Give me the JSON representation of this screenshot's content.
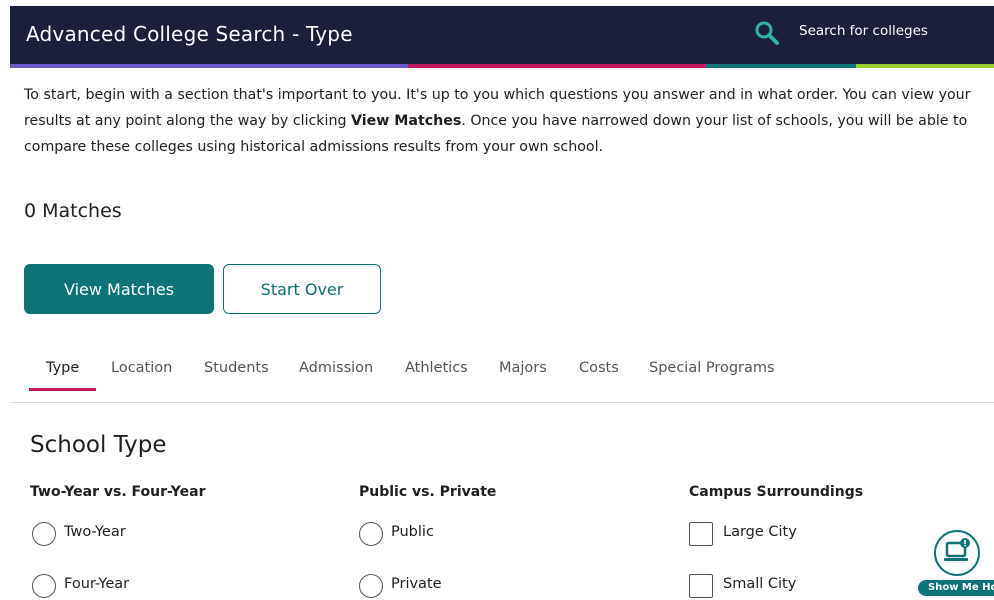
{
  "header": {
    "title": "Advanced College Search - Type",
    "search_label": "Search for colleges",
    "accent_colors": [
      "#6a5acd",
      "#c0175d",
      "#0d7377",
      "#9acd32"
    ]
  },
  "intro": {
    "part1": "To start, begin with a section that's important to you. It's up to you which questions you answer and in what order. You can view your results at any point along the way by clicking ",
    "bold": "View Matches",
    "part2": ". Once you have narrowed down your list of schools, you will be able to compare these colleges using historical admissions results from your own school."
  },
  "matches": {
    "count_text": "0 Matches"
  },
  "buttons": {
    "view_matches": "View Matches",
    "start_over": "Start Over"
  },
  "tabs": [
    {
      "label": "Type",
      "active": true
    },
    {
      "label": "Location"
    },
    {
      "label": "Students"
    },
    {
      "label": "Admission"
    },
    {
      "label": "Athletics"
    },
    {
      "label": "Majors"
    },
    {
      "label": "Costs"
    },
    {
      "label": "Special Programs"
    }
  ],
  "section": {
    "title": "School Type",
    "groups": [
      {
        "heading": "Two-Year vs. Four-Year",
        "type": "radio",
        "options": [
          "Two-Year",
          "Four-Year"
        ]
      },
      {
        "heading": "Public vs. Private",
        "type": "radio",
        "options": [
          "Public",
          "Private"
        ]
      },
      {
        "heading": "Campus Surroundings",
        "type": "checkbox",
        "options": [
          "Large City",
          "Small City"
        ]
      }
    ]
  },
  "help_widget": {
    "label": "Show Me How",
    "icon": "laptop-help-icon"
  },
  "colors": {
    "primary": "#0d7377",
    "header_bg": "#1b1f3a",
    "tab_active": "#c0175d"
  }
}
